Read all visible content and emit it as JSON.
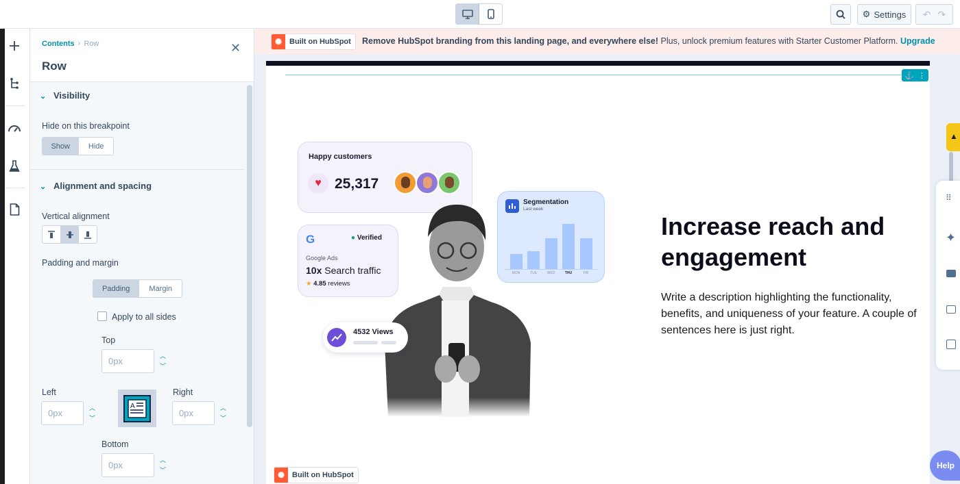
{
  "topbar": {
    "device_desktop_icon": "desktop-icon",
    "device_mobile_icon": "mobile-icon",
    "search_icon": "search-icon",
    "settings_label": "Settings",
    "undo_icon": "undo-icon",
    "redo_icon": "redo-icon"
  },
  "rail": {
    "icons": [
      "plus-icon",
      "tree-icon",
      "gauge-icon",
      "flask-icon",
      "document-icon"
    ]
  },
  "panel": {
    "breadcrumb": {
      "root": "Contents",
      "sep": "›",
      "current": "Row"
    },
    "title": "Row",
    "close": "✕",
    "visibility": {
      "heading": "Visibility",
      "label": "Hide on this breakpoint",
      "options": [
        "Show",
        "Hide"
      ],
      "selected": "Show"
    },
    "alignment": {
      "heading": "Alignment and spacing",
      "vertical_label": "Vertical alignment",
      "vertical_selected": "middle",
      "padding_margin_label": "Padding and margin",
      "tabs": [
        "Padding",
        "Margin"
      ],
      "selected_tab": "Padding",
      "apply_all": "Apply to all sides",
      "apply_all_checked": false,
      "top_label": "Top",
      "left_label": "Left",
      "right_label": "Right",
      "bottom_label": "Bottom",
      "top_placeholder": "0px",
      "left_placeholder": "0px",
      "right_placeholder": "0px",
      "bottom_placeholder": "0px"
    }
  },
  "banner": {
    "badge": "Built on HubSpot",
    "bold": "Remove HubSpot branding from this landing page, and everywhere else!",
    "text": " Plus, unlock premium features with Starter Customer Platform.",
    "link": "Upgrade"
  },
  "page": {
    "heading": "Increase reach and engagement",
    "description": "Write a description highlighting the functionality, benefits, and uniqueness of your feature. A couple of sentences here is just right.",
    "happy": {
      "title": "Happy customers",
      "count": "25,317"
    },
    "google": {
      "verified": "Verified",
      "source": "Google Ads",
      "headline_bold": "10x",
      "headline": " Search traffic",
      "rating": "4.85",
      "reviews": " reviews"
    },
    "views": {
      "text": "4532 Views"
    },
    "segmentation": {
      "title": "Segmentation",
      "subtitle": "Last week",
      "days": [
        "MON",
        "TUE",
        "WED",
        "THU",
        "FRI"
      ],
      "bar_values": [
        0.33,
        0.4,
        0.68,
        1.0,
        0.68
      ]
    },
    "footer_badge": "Built on HubSpot",
    "help": "Help"
  },
  "colors": {
    "accent": "#0091ae",
    "brand": "#ff5c35",
    "chart": "#a7c7ff"
  }
}
